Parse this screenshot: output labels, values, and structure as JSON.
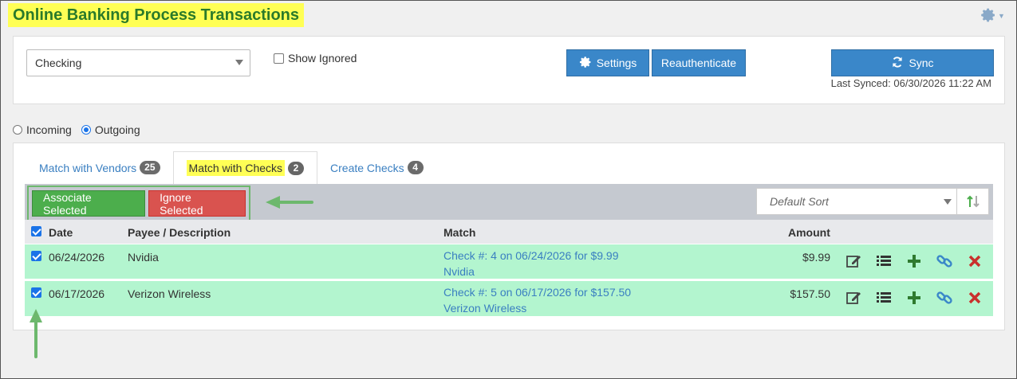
{
  "page_title": "Online Banking Process Transactions",
  "toolbar": {
    "account_selected": "Checking",
    "show_ignored_label": "Show Ignored",
    "show_ignored_checked": false,
    "settings_label": "Settings",
    "reauth_label": "Reauthenticate",
    "sync_label": "Sync",
    "last_synced": "Last Synced: 06/30/2026 11:22 AM"
  },
  "direction": {
    "incoming_label": "Incoming",
    "outgoing_label": "Outgoing",
    "selected": "Outgoing"
  },
  "tabs": [
    {
      "label": "Match with Vendors",
      "count": "25",
      "active": false
    },
    {
      "label": "Match with Checks",
      "count": "2",
      "active": true
    },
    {
      "label": "Create Checks",
      "count": "4",
      "active": false
    }
  ],
  "actions": {
    "associate_label": "Associate Selected",
    "ignore_label": "Ignore Selected",
    "sort_placeholder": "Default Sort"
  },
  "table": {
    "headers": {
      "date": "Date",
      "payee": "Payee / Description",
      "match": "Match",
      "amount": "Amount"
    },
    "rows": [
      {
        "checked": true,
        "date": "06/24/2026",
        "payee": "Nvidia",
        "match_line1": "Check #: 4 on 06/24/2026 for $9.99",
        "match_line2": "Nvidia",
        "amount": "$9.99"
      },
      {
        "checked": true,
        "date": "06/17/2026",
        "payee": "Verizon Wireless",
        "match_line1": "Check #: 5 on 06/17/2026 for $157.50",
        "match_line2": "Verizon Wireless",
        "amount": "$157.50"
      }
    ]
  },
  "colors": {
    "title_highlight": "#ffff55",
    "title_text": "#2a7a2a",
    "primary_blue": "#3a87c9",
    "row_green": "#b3f5cf",
    "action_green": "#4cae4c",
    "action_red": "#d9534f",
    "annotation_green": "#6db86d"
  },
  "icons": [
    "gear-icon",
    "sync-icon",
    "sort-icon",
    "edit-icon",
    "list-icon",
    "plus-icon",
    "link-icon",
    "delete-icon"
  ]
}
